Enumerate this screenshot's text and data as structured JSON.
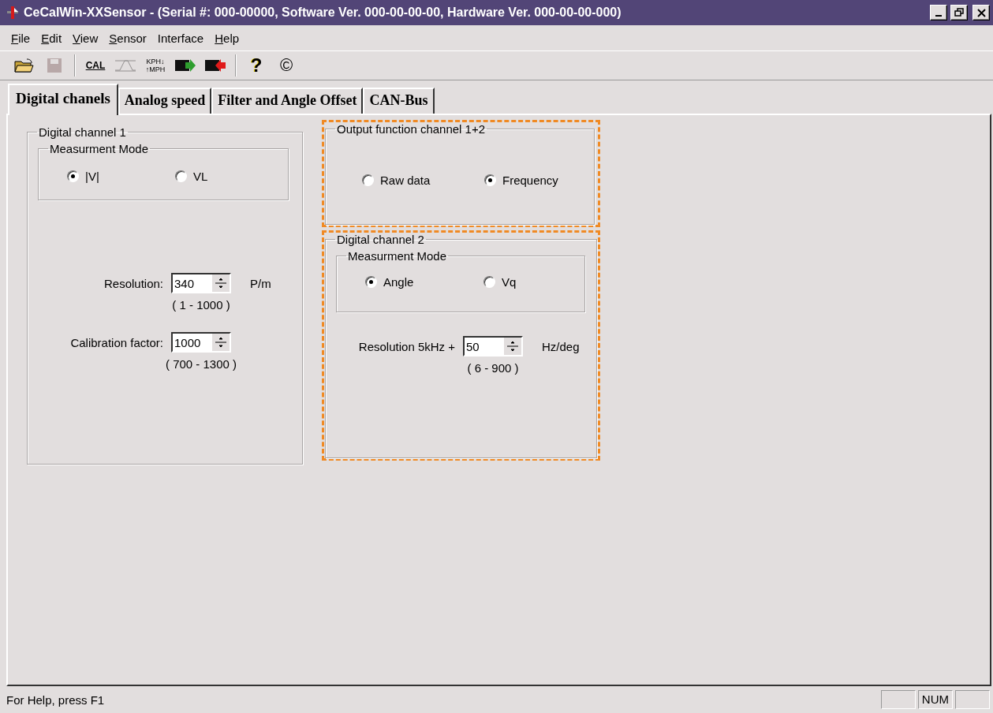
{
  "window": {
    "title": "CeCalWin-XXSensor - (Serial #: 000-00000, Software Ver. 000-00-00-00, Hardware Ver. 000-00-00-000)",
    "controls": [
      {
        "kind": "minimize"
      },
      {
        "kind": "restore"
      },
      {
        "kind": "close"
      }
    ]
  },
  "menu": [
    {
      "label": "File",
      "access_key": true
    },
    {
      "label": "Edit",
      "access_key": true
    },
    {
      "label": "View",
      "access_key": true
    },
    {
      "label": "Sensor",
      "access_key": true
    },
    {
      "label": "Interface",
      "access_key": false
    },
    {
      "label": "Help",
      "access_key": true
    }
  ],
  "toolbar": [
    {
      "kind": "open",
      "disabled": false
    },
    {
      "kind": "save",
      "disabled": true
    },
    {
      "kind": "separator"
    },
    {
      "kind": "cal",
      "text": "CAL",
      "disabled": false
    },
    {
      "kind": "wave",
      "disabled": true
    },
    {
      "kind": "units",
      "text": "KPH↓",
      "text2": "↑MPH",
      "disabled": false
    },
    {
      "kind": "write",
      "disabled": false
    },
    {
      "kind": "read",
      "disabled": false
    },
    {
      "kind": "separator"
    },
    {
      "kind": "help",
      "text": "?",
      "disabled": false
    },
    {
      "kind": "about",
      "text": "©",
      "disabled": false
    }
  ],
  "tabs": [
    {
      "label": "Digital chanels",
      "selected": true
    },
    {
      "label": "Analog speed",
      "selected": false
    },
    {
      "label": "Filter and Angle Offset",
      "selected": false
    },
    {
      "label": "CAN-Bus",
      "selected": false
    }
  ],
  "channel_1": {
    "title": "Digital channel 1",
    "mode": {
      "title": "Measurment Mode",
      "options": [
        {
          "label": "|V|",
          "selected": true
        },
        {
          "label": "VL",
          "selected": false
        }
      ]
    },
    "fields": [
      {
        "label": "Resolution:",
        "value": "340",
        "unit": "P/m",
        "range": "( 1 - 1000 )"
      },
      {
        "label": "Calibration factor:",
        "value": "1000",
        "range": "( 700 - 1300 )"
      }
    ]
  },
  "output_function": {
    "title": "Output function channel 1+2",
    "highlighted": true,
    "options": [
      {
        "label": "Raw data",
        "selected": false
      },
      {
        "label": "Frequency",
        "selected": true
      }
    ]
  },
  "channel_2": {
    "title": "Digital channel 2",
    "highlighted": true,
    "mode": {
      "title": "Measurment Mode",
      "options": [
        {
          "label": "Angle",
          "selected": true
        },
        {
          "label": "Vq",
          "selected": false
        }
      ]
    },
    "fields": [
      {
        "label": "Resolution 5kHz +",
        "value": "50",
        "unit": "Hz/deg",
        "range": "( 6 - 900 )"
      }
    ]
  },
  "status_bar": {
    "text": "For Help, press F1",
    "panels": [
      {
        "kind": "blank"
      },
      {
        "kind": "text",
        "text": "NUM"
      },
      {
        "kind": "blank"
      }
    ]
  }
}
